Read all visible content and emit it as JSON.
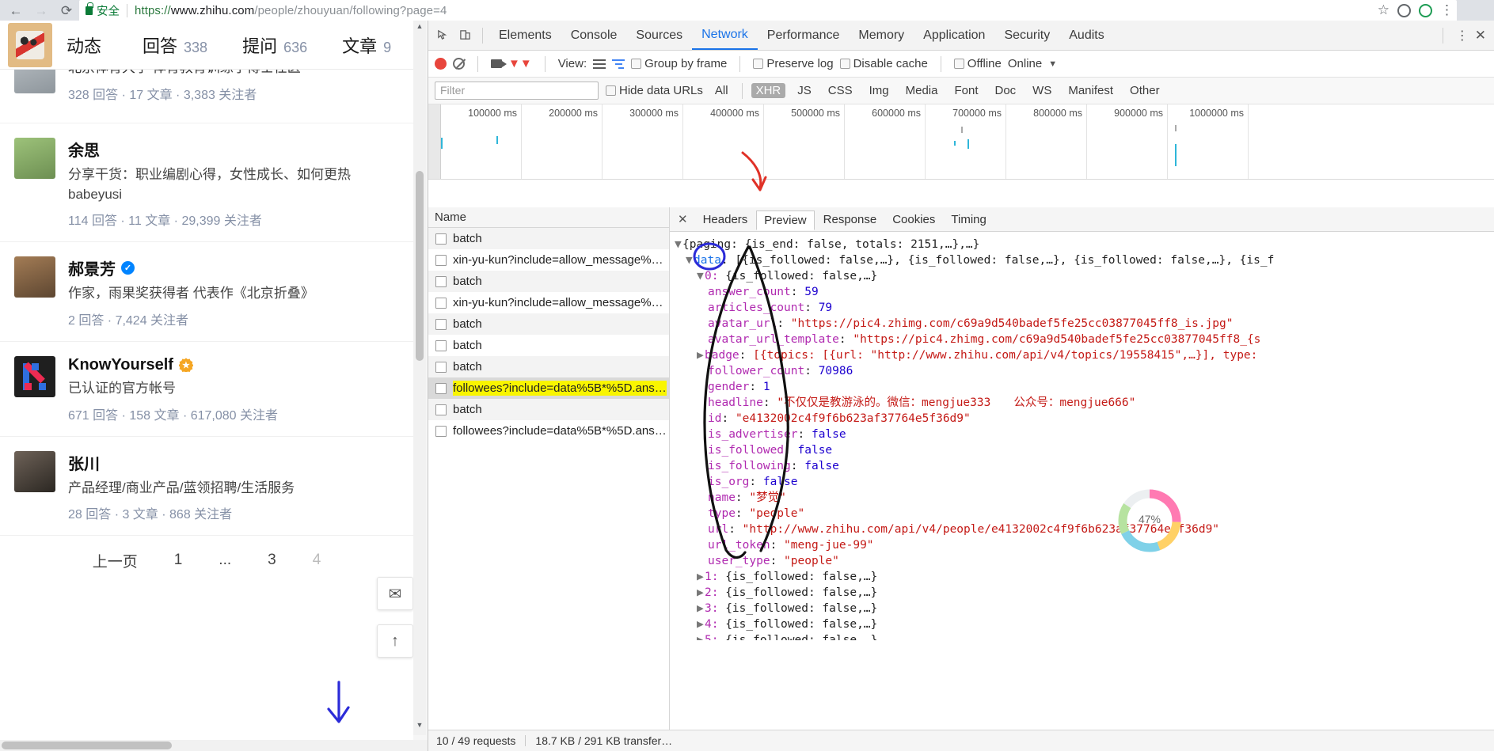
{
  "browser": {
    "back_icon": "←",
    "forward_icon": "→",
    "reload_icon": "⟳",
    "secure_label": "安全",
    "url_scheme": "https://",
    "url_domain": "www.zhihu.com",
    "url_path": "/people/zhouyuan/following?page=4",
    "star_icon": "☆",
    "menu_icon": "⋮"
  },
  "zhihu": {
    "nav": [
      {
        "label": "动态",
        "count": ""
      },
      {
        "label": "回答",
        "count": "338"
      },
      {
        "label": "提问",
        "count": "636"
      },
      {
        "label": "文章",
        "count": "9"
      }
    ],
    "people": [
      {
        "name": "",
        "desc": "北京体育大学 体育教育训练学博士任医",
        "meta": "328 回答 · 17 文章 · 3,383 关注者",
        "badge": "",
        "avatar_color": "#9aa3ab"
      },
      {
        "name": "余思",
        "desc": "分享干货：职业编剧心得，女性成长、如何更热 babeyusi",
        "meta": "114 回答 · 11 文章 · 29,399 关注者",
        "badge": "",
        "avatar_color": "#7fa35c"
      },
      {
        "name": "郝景芳",
        "desc": "作家，雨果奖获得者 代表作《北京折叠》",
        "meta": "2 回答 · 7,424 关注者",
        "badge": "verified",
        "avatar_color": "#8a6a4a"
      },
      {
        "name": "KnowYourself",
        "desc": "已认证的官方帐号",
        "meta": "671 回答 · 158 文章 · 617,080 关注者",
        "badge": "org",
        "avatar_color": "#1f1f1f"
      },
      {
        "name": "张川",
        "desc": "产品经理/商业产品/蓝领招聘/生活服务",
        "meta": "28 回答 · 3 文章 · 868 关注者",
        "badge": "",
        "avatar_color": "#4a4440"
      }
    ],
    "pager": {
      "prev": "上一页",
      "pages": [
        "1",
        "...",
        "3",
        "4"
      ],
      "current": "4"
    },
    "fab_inbox_icon": "✉",
    "fab_top_icon": "↑"
  },
  "devtools": {
    "tabs": [
      "Elements",
      "Console",
      "Sources",
      "Network",
      "Performance",
      "Memory",
      "Application",
      "Security",
      "Audits"
    ],
    "active_tab": "Network",
    "more_icon": "⋮",
    "close_icon": "✕",
    "inspect_icon": "inspect-element",
    "device_icon": "toggle-device-toolbar",
    "toolbar": {
      "view_label": "View:",
      "group_by_frame": "Group by frame",
      "preserve_log": "Preserve log",
      "disable_cache": "Disable cache",
      "offline": "Offline",
      "online": "Online",
      "dropdown_icon": "▼"
    },
    "filterbar": {
      "filter_placeholder": "Filter",
      "hide_data_urls": "Hide data URLs",
      "types": [
        "All",
        "XHR",
        "JS",
        "CSS",
        "Img",
        "Media",
        "Font",
        "Doc",
        "WS",
        "Manifest",
        "Other"
      ],
      "active_type": "XHR"
    },
    "timeline": {
      "labels": [
        "100000 ms",
        "200000 ms",
        "300000 ms",
        "400000 ms",
        "500000 ms",
        "600000 ms",
        "700000 ms",
        "800000 ms",
        "900000 ms",
        "1000000 ms"
      ]
    },
    "requests": {
      "column_name": "Name",
      "rows": [
        {
          "name": "batch",
          "selected": false,
          "highlight": false
        },
        {
          "name": "xin-yu-kun?include=allow_message%…",
          "selected": false,
          "highlight": false
        },
        {
          "name": "batch",
          "selected": false,
          "highlight": false
        },
        {
          "name": "xin-yu-kun?include=allow_message%…",
          "selected": false,
          "highlight": false
        },
        {
          "name": "batch",
          "selected": false,
          "highlight": false
        },
        {
          "name": "batch",
          "selected": false,
          "highlight": false
        },
        {
          "name": "batch",
          "selected": false,
          "highlight": false
        },
        {
          "name": "followees?include=data%5B*%5D.ans…",
          "selected": true,
          "highlight": true
        },
        {
          "name": "batch",
          "selected": false,
          "highlight": false
        },
        {
          "name": "followees?include=data%5B*%5D.ans…",
          "selected": false,
          "highlight": false
        }
      ]
    },
    "detail_tabs": [
      "Headers",
      "Preview",
      "Response",
      "Cookies",
      "Timing"
    ],
    "detail_active": "Preview",
    "status": {
      "requests": "10 / 49 requests",
      "transferred": "18.7 KB / 291 KB transfer…"
    },
    "preview": {
      "line_root": "{paging: {is_end: false, totals: 2151,…},…}",
      "line_data": "data: [{is_followed: false,…}, {is_followed: false,…}, {is_followed: false,…}, {is_f",
      "line_zero_key": "0:",
      "line_zero_val": "{is_followed: false,…}",
      "fields": [
        {
          "key": "answer_count",
          "val": "59",
          "type": "num"
        },
        {
          "key": "articles_count",
          "val": "79",
          "type": "num"
        },
        {
          "key": "avatar_url",
          "val": "\"https://pic4.zhimg.com/c69a9d540badef5fe25cc03877045ff8_is.jpg\"",
          "type": "str"
        },
        {
          "key": "avatar_url_template",
          "val": "\"https://pic4.zhimg.com/c69a9d540badef5fe25cc03877045ff8_{s",
          "type": "str"
        },
        {
          "key": "badge",
          "val": "[{topics: [{url: \"http://www.zhihu.com/api/v4/topics/19558415\",…}], type:",
          "type": "mix",
          "expandable": true
        },
        {
          "key": "follower_count",
          "val": "70986",
          "type": "num"
        },
        {
          "key": "gender",
          "val": "1",
          "type": "num"
        },
        {
          "key": "headline",
          "val": "\"不仅仅是教游泳的。微信：mengjue333　　公众号：mengjue666\"",
          "type": "str"
        },
        {
          "key": "id",
          "val": "\"e4132002c4f9f6b623af37764e5f36d9\"",
          "type": "str"
        },
        {
          "key": "is_advertiser",
          "val": "false",
          "type": "bool"
        },
        {
          "key": "is_followed",
          "val": "false",
          "type": "bool"
        },
        {
          "key": "is_following",
          "val": "false",
          "type": "bool"
        },
        {
          "key": "is_org",
          "val": "false",
          "type": "bool"
        },
        {
          "key": "name",
          "val": "\"梦觉\"",
          "type": "str"
        },
        {
          "key": "type",
          "val": "\"people\"",
          "type": "str"
        },
        {
          "key": "url",
          "val": "\"http://www.zhihu.com/api/v4/people/e4132002c4f9f6b623af37764e5f36d9\"",
          "type": "str"
        },
        {
          "key": "url_token",
          "val": "\"meng-jue-99\"",
          "type": "str"
        },
        {
          "key": "user_type",
          "val": "\"people\"",
          "type": "str"
        }
      ],
      "siblings": [
        {
          "idx": "1:",
          "val": "{is_followed: false,…}"
        },
        {
          "idx": "2:",
          "val": "{is_followed: false,…}"
        },
        {
          "idx": "3:",
          "val": "{is_followed: false,…}"
        },
        {
          "idx": "4:",
          "val": "{is_followed: false,…}"
        },
        {
          "idx": "5:",
          "val": "{is_followed: false,…}"
        }
      ]
    }
  },
  "overlay": {
    "progress_percent": "47%",
    "annotation_colors": {
      "red": "#e03127",
      "blue": "#2b2bd8",
      "black": "#111111",
      "highlight": "#f9f500"
    }
  }
}
